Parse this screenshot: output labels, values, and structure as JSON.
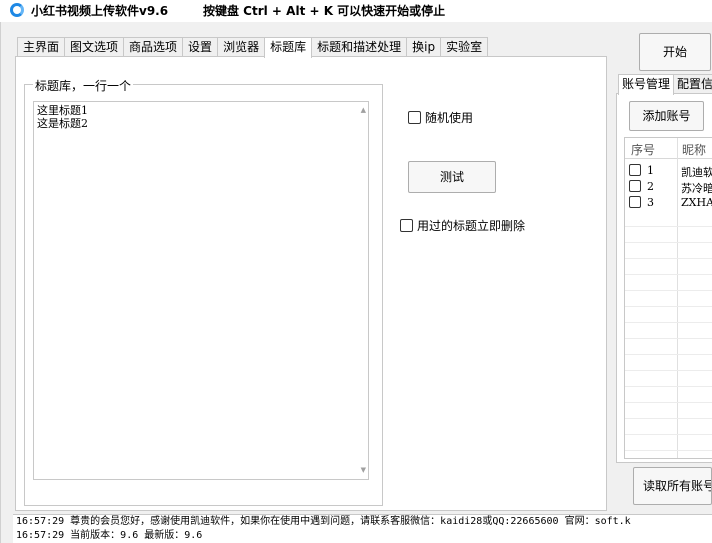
{
  "app": {
    "title": "小红书视频上传软件v9.6",
    "hotkey_hint": "按键盘 Ctrl + Alt + K  可以快速开始或停止"
  },
  "tabs": [
    "主界面",
    "图文选项",
    "商品选项",
    "设置",
    "浏览器",
    "标题库",
    "标题和描述处理",
    "换ip",
    "实验室"
  ],
  "active_tab": "标题库",
  "title_library": {
    "group_label": "标题库，一行一个",
    "lines": [
      "这里标题1",
      "这是标题2"
    ],
    "random_use_label": "随机使用",
    "random_use_checked": false,
    "test_button": "测试",
    "delete_used_label": "用过的标题立即删除",
    "delete_used_checked": false
  },
  "start_button": "开始",
  "right_tabs": [
    "账号管理",
    "配置信"
  ],
  "accounts": {
    "add_button": "添加账号",
    "columns": [
      "序号",
      "昵称"
    ],
    "rows": [
      {
        "index": "1",
        "nickname": "凯迪软",
        "checked": false
      },
      {
        "index": "2",
        "nickname": "苏冷暗",
        "checked": false
      },
      {
        "index": "3",
        "nickname": "ZXHASI",
        "checked": false
      }
    ],
    "read_all_button": "读取所有账号"
  },
  "log": [
    "16:57:29 尊贵的会员您好，感谢使用凯迪软件，如果你在使用中遇到问题，请联系客服微信：kaidi28或QQ:22665600 官网：soft.k",
    "16:57:29 当前版本：9.6   最新版：9.6"
  ]
}
